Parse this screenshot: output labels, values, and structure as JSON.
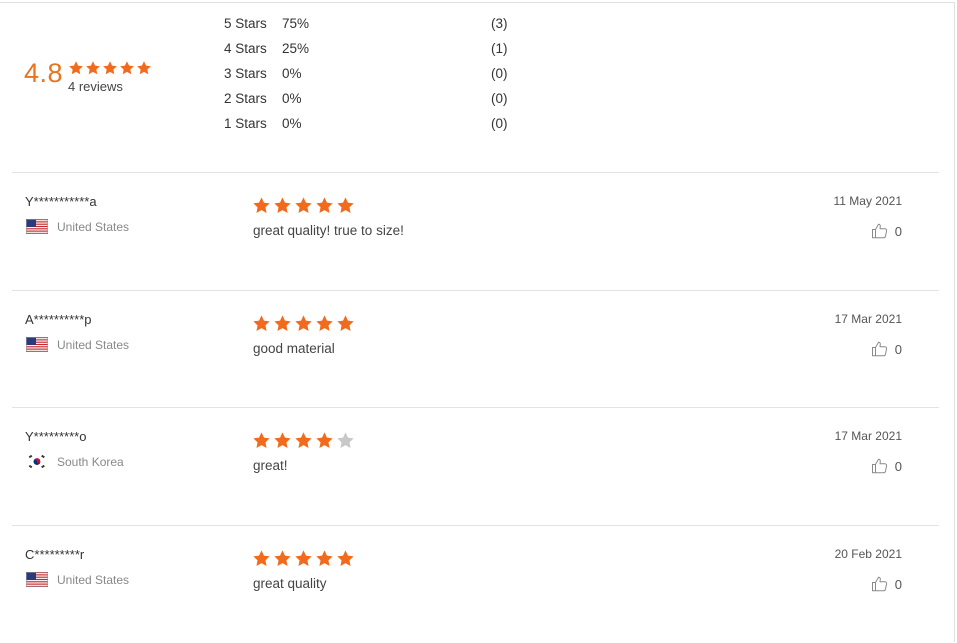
{
  "summary": {
    "average": "4.8",
    "average_stars": 5,
    "review_count": "4 reviews",
    "distribution": [
      {
        "label": "5  Stars",
        "percent": "75%",
        "count": "(3)"
      },
      {
        "label": "4  Stars",
        "percent": "25%",
        "count": "(1)"
      },
      {
        "label": "3  Stars",
        "percent": "0%",
        "count": "(0)"
      },
      {
        "label": "2  Stars",
        "percent": "0%",
        "count": "(0)"
      },
      {
        "label": "1  Stars",
        "percent": "0%",
        "count": "(0)"
      }
    ]
  },
  "colors": {
    "accent": "#f26b1d",
    "star_empty": "#c8c8c8"
  },
  "reviews": [
    {
      "name": "Y***********a",
      "country": "United States",
      "flag": "us-flag-icon",
      "rating": 5,
      "text": "great quality! true to size!",
      "date": "11 May 2021",
      "likes": "0"
    },
    {
      "name": "A**********p",
      "country": "United States",
      "flag": "us-flag-icon",
      "rating": 5,
      "text": "good material",
      "date": "17 Mar 2021",
      "likes": "0"
    },
    {
      "name": "Y*********o",
      "country": "South Korea",
      "flag": "kr-flag-icon",
      "rating": 4,
      "text": "great!",
      "date": "17 Mar 2021",
      "likes": "0"
    },
    {
      "name": "C*********r",
      "country": "United States",
      "flag": "us-flag-icon",
      "rating": 5,
      "text": "great quality",
      "date": "20 Feb 2021",
      "likes": "0"
    }
  ]
}
